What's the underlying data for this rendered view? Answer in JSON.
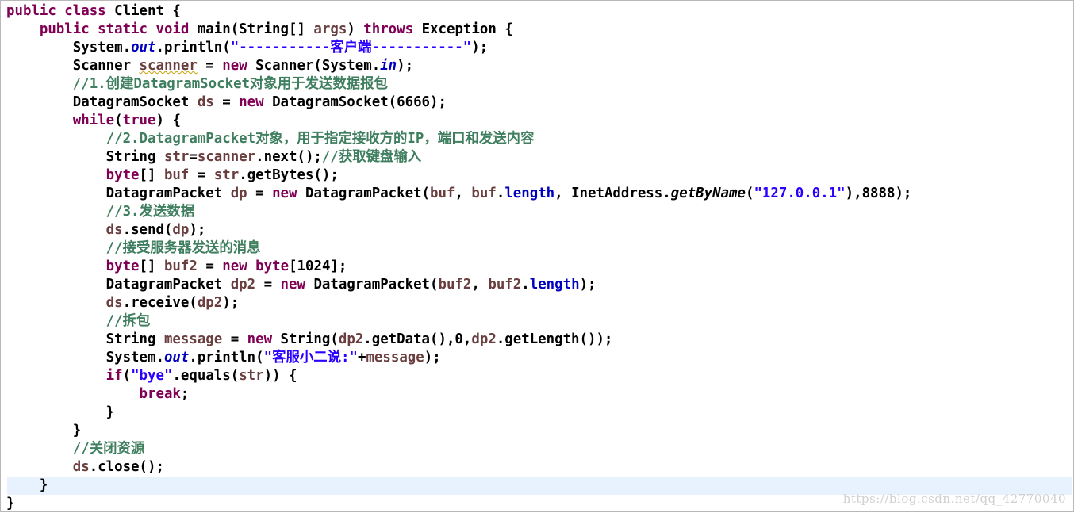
{
  "editor": {
    "lines": [
      [
        {
          "t": "public class ",
          "c": "kw"
        },
        {
          "t": "Client {"
        }
      ],
      [
        {
          "t": "    "
        },
        {
          "t": "public static void ",
          "c": "kw"
        },
        {
          "t": "main(String[] "
        },
        {
          "t": "args",
          "c": "local"
        },
        {
          "t": ") "
        },
        {
          "t": "throws",
          "c": "kw"
        },
        {
          "t": " Exception {"
        }
      ],
      [
        {
          "t": "        System."
        },
        {
          "t": "out",
          "c": "sfield"
        },
        {
          "t": ".println("
        },
        {
          "t": "\"-----------客户端-----------\"",
          "c": "str"
        },
        {
          "t": ");"
        }
      ],
      [
        {
          "t": "        Scanner "
        },
        {
          "t": "scanner",
          "c": "local warn"
        },
        {
          "t": " = "
        },
        {
          "t": "new",
          "c": "kw"
        },
        {
          "t": " Scanner(System."
        },
        {
          "t": "in",
          "c": "sfield"
        },
        {
          "t": ");"
        }
      ],
      [
        {
          "t": "        //1.创建DatagramSocket对象用于发送数据报包",
          "c": "cmt"
        }
      ],
      [
        {
          "t": "        DatagramSocket "
        },
        {
          "t": "ds",
          "c": "local"
        },
        {
          "t": " = "
        },
        {
          "t": "new",
          "c": "kw"
        },
        {
          "t": " DatagramSocket(6666);"
        }
      ],
      [
        {
          "t": "        "
        },
        {
          "t": "while",
          "c": "kw"
        },
        {
          "t": "("
        },
        {
          "t": "true",
          "c": "kw"
        },
        {
          "t": ") {"
        }
      ],
      [
        {
          "t": "            //2.DatagramPacket对象，用于指定接收方的IP，端口和发送内容",
          "c": "cmt"
        }
      ],
      [
        {
          "t": "            String "
        },
        {
          "t": "str",
          "c": "local"
        },
        {
          "t": "="
        },
        {
          "t": "scanner",
          "c": "local"
        },
        {
          "t": ".next();"
        },
        {
          "t": "//获取键盘输入",
          "c": "cmt"
        }
      ],
      [
        {
          "t": "            "
        },
        {
          "t": "byte",
          "c": "kw"
        },
        {
          "t": "[] "
        },
        {
          "t": "buf",
          "c": "local"
        },
        {
          "t": " = "
        },
        {
          "t": "str",
          "c": "local"
        },
        {
          "t": ".getBytes();"
        }
      ],
      [
        {
          "t": "            DatagramPacket "
        },
        {
          "t": "dp",
          "c": "local"
        },
        {
          "t": " = "
        },
        {
          "t": "new",
          "c": "kw"
        },
        {
          "t": " DatagramPacket("
        },
        {
          "t": "buf",
          "c": "local"
        },
        {
          "t": ", "
        },
        {
          "t": "buf",
          "c": "local"
        },
        {
          "t": "."
        },
        {
          "t": "length",
          "c": "field"
        },
        {
          "t": ", InetAddress."
        },
        {
          "t": "getByName",
          "c": "smeth"
        },
        {
          "t": "("
        },
        {
          "t": "\"127.0.0.1\"",
          "c": "str"
        },
        {
          "t": "),8888);"
        }
      ],
      [
        {
          "t": "            //3.发送数据",
          "c": "cmt"
        }
      ],
      [
        {
          "t": "            "
        },
        {
          "t": "ds",
          "c": "local"
        },
        {
          "t": ".send("
        },
        {
          "t": "dp",
          "c": "local"
        },
        {
          "t": ");"
        }
      ],
      [
        {
          "t": "            //接受服务器发送的消息",
          "c": "cmt"
        }
      ],
      [
        {
          "t": "            "
        },
        {
          "t": "byte",
          "c": "kw"
        },
        {
          "t": "[] "
        },
        {
          "t": "buf2",
          "c": "local"
        },
        {
          "t": " = "
        },
        {
          "t": "new",
          "c": "kw"
        },
        {
          "t": " "
        },
        {
          "t": "byte",
          "c": "kw"
        },
        {
          "t": "[1024];"
        }
      ],
      [
        {
          "t": "            DatagramPacket "
        },
        {
          "t": "dp2",
          "c": "local"
        },
        {
          "t": " = "
        },
        {
          "t": "new",
          "c": "kw"
        },
        {
          "t": " DatagramPacket("
        },
        {
          "t": "buf2",
          "c": "local"
        },
        {
          "t": ", "
        },
        {
          "t": "buf2",
          "c": "local"
        },
        {
          "t": "."
        },
        {
          "t": "length",
          "c": "field"
        },
        {
          "t": ");"
        }
      ],
      [
        {
          "t": "            "
        },
        {
          "t": "ds",
          "c": "local"
        },
        {
          "t": ".receive("
        },
        {
          "t": "dp2",
          "c": "local"
        },
        {
          "t": ");"
        }
      ],
      [
        {
          "t": "            //拆包",
          "c": "cmt"
        }
      ],
      [
        {
          "t": "            String "
        },
        {
          "t": "message",
          "c": "local"
        },
        {
          "t": " = "
        },
        {
          "t": "new",
          "c": "kw"
        },
        {
          "t": " String("
        },
        {
          "t": "dp2",
          "c": "local"
        },
        {
          "t": ".getData(),0,"
        },
        {
          "t": "dp2",
          "c": "local"
        },
        {
          "t": ".getLength());"
        }
      ],
      [
        {
          "t": "            System."
        },
        {
          "t": "out",
          "c": "sfield"
        },
        {
          "t": ".println("
        },
        {
          "t": "\"客服小二说:\"",
          "c": "str"
        },
        {
          "t": "+"
        },
        {
          "t": "message",
          "c": "local"
        },
        {
          "t": ");"
        }
      ],
      [
        {
          "t": "            "
        },
        {
          "t": "if",
          "c": "kw"
        },
        {
          "t": "("
        },
        {
          "t": "\"bye\"",
          "c": "str"
        },
        {
          "t": ".equals("
        },
        {
          "t": "str",
          "c": "local"
        },
        {
          "t": ")) {"
        }
      ],
      [
        {
          "t": "                "
        },
        {
          "t": "break",
          "c": "kw"
        },
        {
          "t": ";"
        }
      ],
      [
        {
          "t": "            }"
        }
      ],
      [
        {
          "t": "        }"
        }
      ],
      [
        {
          "t": "        //关闭资源",
          "c": "cmt"
        }
      ],
      [
        {
          "t": "        "
        },
        {
          "t": "ds",
          "c": "local"
        },
        {
          "t": ".close();"
        }
      ],
      [
        {
          "t": "    }"
        }
      ],
      [
        {
          "t": "}"
        }
      ]
    ],
    "current_line_index": 26
  },
  "watermark": "https://blog.csdn.net/qq_42770040",
  "colors": {
    "keyword": "#7f0055",
    "string": "#2a00ff",
    "comment": "#3f7f5f",
    "field": "#0000c0",
    "local_variable": "#6a3e3e",
    "current_line": "#e8f2fe"
  }
}
